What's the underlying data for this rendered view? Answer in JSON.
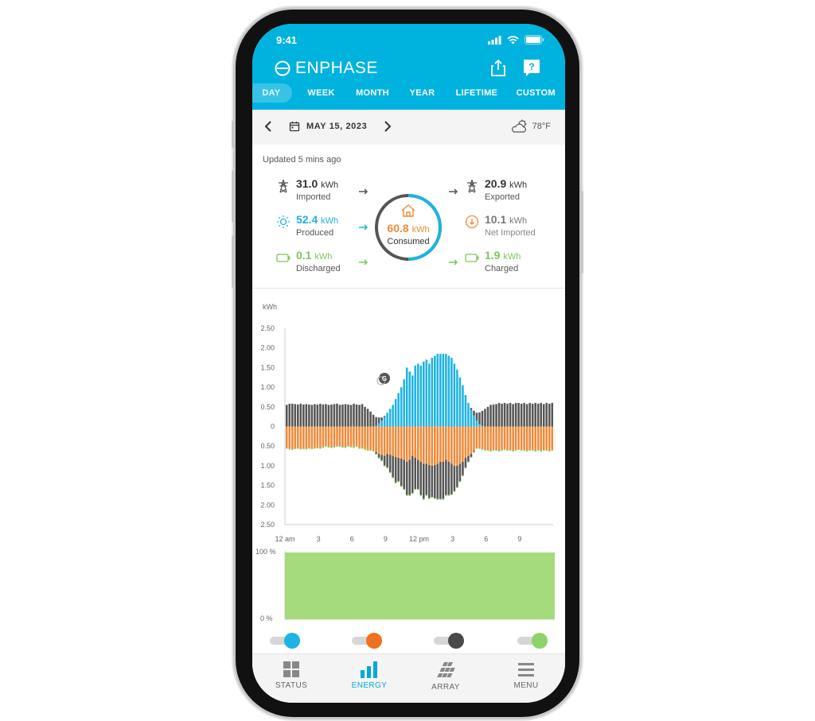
{
  "status_bar": {
    "time": "9:41"
  },
  "header": {
    "brand": "ENPHASE",
    "share_icon": "share-icon",
    "help_icon": "help-icon"
  },
  "tabs": [
    {
      "label": "DAY",
      "active": true
    },
    {
      "label": "WEEK",
      "active": false
    },
    {
      "label": "MONTH",
      "active": false
    },
    {
      "label": "YEAR",
      "active": false
    },
    {
      "label": "LIFETIME",
      "active": false
    },
    {
      "label": "CUSTOM",
      "active": false
    }
  ],
  "date_bar": {
    "date": "MAY 15, 2023",
    "temperature": "78°F"
  },
  "summary": {
    "updated": "Updated 5 mins ago",
    "imported": {
      "value": "31.0",
      "unit": "kWh",
      "label": "Imported"
    },
    "produced": {
      "value": "52.4",
      "unit": "kWh",
      "label": "Produced"
    },
    "discharged": {
      "value": "0.1",
      "unit": "kWh",
      "label": "Discharged"
    },
    "exported": {
      "value": "20.9",
      "unit": "kWh",
      "label": "Exported"
    },
    "net_imported": {
      "value": "10.1",
      "unit": "kWh",
      "label": "Net Imported"
    },
    "charged": {
      "value": "1.9",
      "unit": "kWh",
      "label": "Charged"
    },
    "consumed": {
      "value": "60.8",
      "unit": "kWh",
      "label": "Consumed"
    }
  },
  "colors": {
    "solar": "#1eb3e2",
    "consumption": "#f08a3a",
    "grid": "#555555",
    "battery": "#8ed26a",
    "header": "#00b3df"
  },
  "chart_data": [
    {
      "type": "bar",
      "ylabel": "kWh",
      "y_tick_labels": [
        "2.50",
        "2.00",
        "1.50",
        "1.00",
        "0.50",
        "0",
        "0.50",
        "1.00",
        "1.50",
        "2.00",
        "2.50"
      ],
      "ylim": [
        -2.5,
        2.5
      ],
      "x_tick_labels": [
        "12 am",
        "3",
        "6",
        "9",
        "12 pm",
        "3",
        "6",
        "9"
      ],
      "marker_label": "G",
      "interval_minutes": 15,
      "series": [
        {
          "key": "solar",
          "values": [
            0,
            0,
            0,
            0,
            0,
            0,
            0,
            0,
            0,
            0,
            0,
            0,
            0,
            0,
            0,
            0,
            0,
            0,
            0,
            0,
            0,
            0,
            0,
            0,
            0,
            0,
            0,
            0,
            0,
            0,
            0,
            0,
            0.02,
            0.08,
            0.15,
            0.25,
            0.35,
            0.45,
            0.55,
            0.7,
            0.85,
            1.0,
            1.2,
            1.5,
            1.4,
            1.3,
            1.55,
            1.6,
            1.55,
            1.65,
            1.7,
            1.6,
            1.75,
            1.8,
            1.85,
            1.85,
            1.85,
            1.85,
            1.8,
            1.75,
            1.6,
            1.45,
            1.25,
            1.05,
            0.8,
            0.6,
            0.42,
            0.28,
            0.15,
            0.06,
            0.02,
            0,
            0,
            0,
            0,
            0,
            0,
            0,
            0,
            0,
            0,
            0,
            0,
            0,
            0,
            0,
            0,
            0,
            0,
            0,
            0,
            0,
            0,
            0,
            0,
            0
          ]
        },
        {
          "key": "grid_import",
          "values": [
            0.55,
            0.58,
            0.58,
            0.57,
            0.56,
            0.58,
            0.56,
            0.57,
            0.56,
            0.55,
            0.57,
            0.56,
            0.58,
            0.56,
            0.57,
            0.55,
            0.56,
            0.57,
            0.58,
            0.55,
            0.56,
            0.57,
            0.56,
            0.55,
            0.58,
            0.56,
            0.55,
            0.57,
            0.5,
            0.45,
            0.38,
            0.3,
            0.22,
            0.15,
            0.08,
            0.02,
            0,
            0,
            0,
            0,
            0,
            0,
            0,
            0,
            0,
            0,
            0,
            0,
            0,
            0,
            0,
            0,
            0,
            0,
            0,
            0,
            0,
            0,
            0,
            0,
            0,
            0,
            0,
            0,
            0,
            0,
            0.05,
            0.12,
            0.2,
            0.3,
            0.38,
            0.45,
            0.5,
            0.55,
            0.56,
            0.57,
            0.6,
            0.58,
            0.6,
            0.58,
            0.6,
            0.57,
            0.6,
            0.6,
            0.58,
            0.6,
            0.57,
            0.6,
            0.58,
            0.6,
            0.58,
            0.6,
            0.57,
            0.6,
            0.58,
            0.6
          ]
        },
        {
          "key": "consumption",
          "values": [
            -0.55,
            -0.57,
            -0.58,
            -0.56,
            -0.55,
            -0.57,
            -0.56,
            -0.57,
            -0.55,
            -0.56,
            -0.55,
            -0.54,
            -0.55,
            -0.53,
            -0.5,
            -0.52,
            -0.53,
            -0.52,
            -0.5,
            -0.5,
            -0.52,
            -0.53,
            -0.5,
            -0.52,
            -0.53,
            -0.5,
            -0.55,
            -0.55,
            -0.58,
            -0.6,
            -0.6,
            -0.62,
            -0.65,
            -0.7,
            -0.72,
            -0.75,
            -0.7,
            -0.72,
            -0.75,
            -0.78,
            -0.8,
            -0.82,
            -0.85,
            -0.9,
            -0.85,
            -0.75,
            -0.8,
            -0.85,
            -0.9,
            -0.95,
            -0.95,
            -0.98,
            -1.0,
            -0.98,
            -0.95,
            -0.9,
            -0.9,
            -0.85,
            -0.9,
            -0.95,
            -1.0,
            -1.0,
            -0.95,
            -0.9,
            -0.8,
            -0.75,
            -0.7,
            -0.62,
            -0.55,
            -0.55,
            -0.58,
            -0.6,
            -0.6,
            -0.62,
            -0.6,
            -0.6,
            -0.62,
            -0.6,
            -0.58,
            -0.6,
            -0.6,
            -0.62,
            -0.6,
            -0.58,
            -0.6,
            -0.6,
            -0.62,
            -0.6,
            -0.6,
            -0.62,
            -0.6,
            -0.62,
            -0.6,
            -0.6,
            -0.62,
            -0.6
          ]
        },
        {
          "key": "grid_export",
          "values": [
            0,
            0,
            0,
            0,
            0,
            0,
            0,
            0,
            0,
            0,
            0,
            0,
            0,
            0,
            0,
            0,
            0,
            0,
            0,
            0,
            0,
            0,
            0,
            0,
            0,
            0,
            0,
            0,
            0,
            0,
            0,
            0,
            -0.05,
            -0.1,
            -0.15,
            -0.25,
            -0.35,
            -0.45,
            -0.55,
            -0.65,
            -0.6,
            -0.7,
            -0.75,
            -0.85,
            -0.9,
            -0.95,
            -0.8,
            -0.75,
            -0.85,
            -0.9,
            -0.8,
            -0.85,
            -0.8,
            -0.85,
            -0.9,
            -0.95,
            -0.95,
            -0.9,
            -0.85,
            -0.78,
            -0.65,
            -0.55,
            -0.45,
            -0.35,
            -0.25,
            -0.15,
            -0.08,
            -0.03,
            0,
            0,
            0,
            0,
            0,
            0,
            0,
            0,
            0,
            0,
            0,
            0,
            0,
            0,
            0,
            0,
            0,
            0,
            0,
            0,
            0,
            0,
            0,
            0,
            0,
            0,
            0,
            0
          ]
        }
      ]
    },
    {
      "type": "area",
      "y_tick_labels": [
        "100 %",
        "0 %"
      ],
      "ylim": [
        0,
        100
      ],
      "values": [
        100,
        100
      ]
    }
  ],
  "toggles": [
    {
      "name": "solar",
      "on": true
    },
    {
      "name": "consumption",
      "on": true
    },
    {
      "name": "grid",
      "on": true
    },
    {
      "name": "battery",
      "on": true
    }
  ],
  "nav": [
    {
      "label": "STATUS",
      "icon": "status-grid-icon",
      "active": false
    },
    {
      "label": "ENERGY",
      "icon": "energy-bars-icon",
      "active": true
    },
    {
      "label": "ARRAY",
      "icon": "array-panels-icon",
      "active": false
    },
    {
      "label": "MENU",
      "icon": "menu-icon",
      "active": false
    }
  ]
}
